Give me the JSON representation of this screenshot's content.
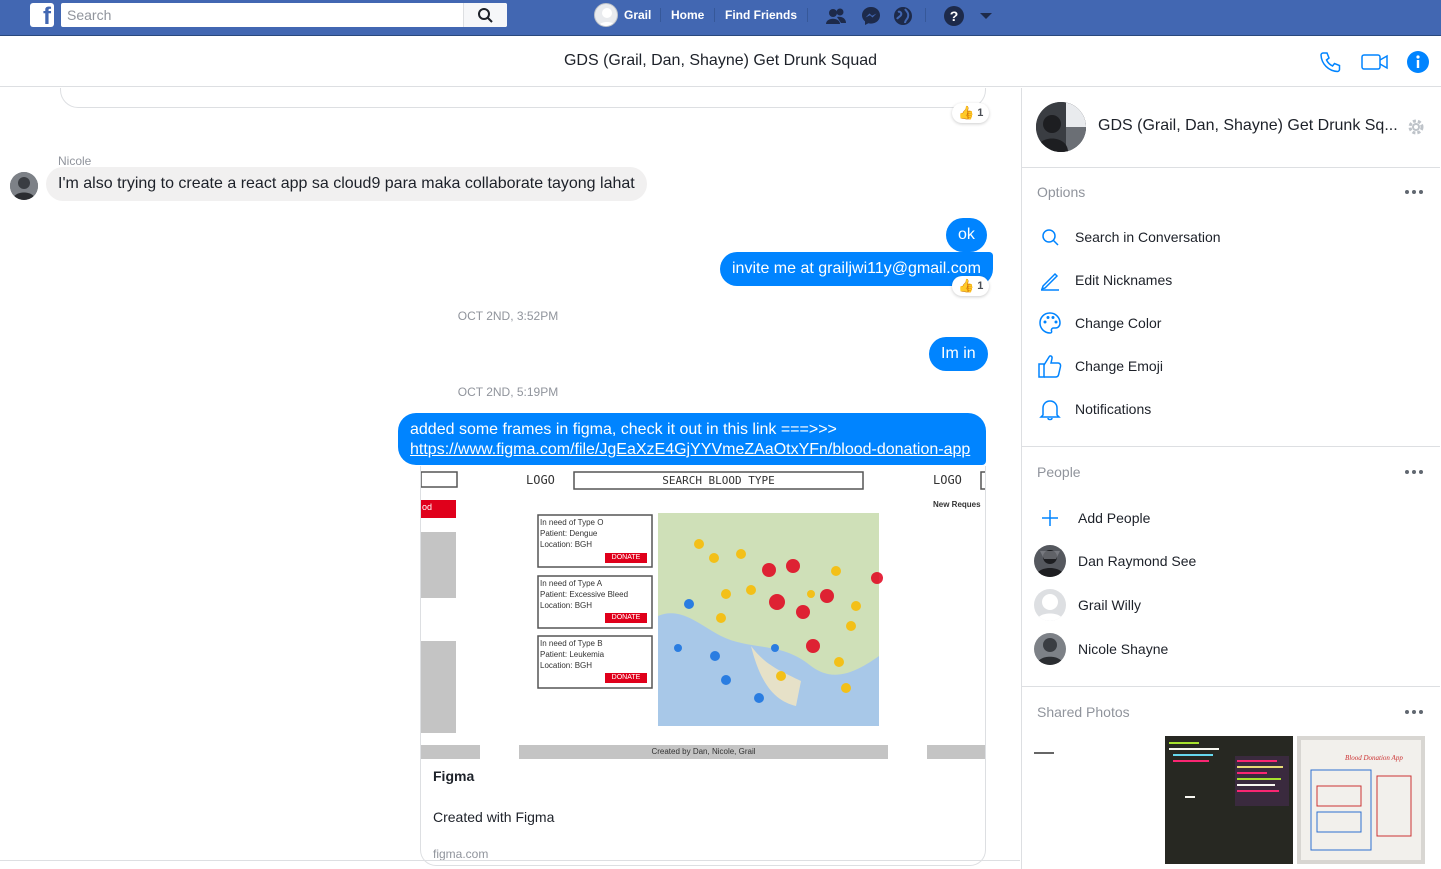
{
  "topbar": {
    "logo": "f",
    "search_placeholder": "Search",
    "user_name": "Grail",
    "home": "Home",
    "find_friends": "Find Friends",
    "icons": [
      "friend-requests-icon",
      "messenger-icon",
      "notifications-globe-icon",
      "help-icon",
      "dropdown-caret-icon"
    ]
  },
  "conversation": {
    "title": "GDS (Grail, Dan, Shayne) Get Drunk Squad",
    "header_icons": [
      "phone-icon",
      "video-icon",
      "info-icon"
    ]
  },
  "chat": {
    "top_reaction_count": "1",
    "sender_name": "Nicole",
    "incoming_message": "I'm also trying to create a react app sa cloud9 para maka collaborate tayong lahat",
    "out_ok": "ok",
    "out_invite": "invite me at grailjwi11y@gmail.com",
    "invite_reaction_count": "1",
    "timestamp_1": "OCT 2ND, 3:52PM",
    "out_im_in": "Im in",
    "timestamp_2": "OCT 2ND, 5:19PM",
    "link_message_text": "added some frames in figma, check it out in this link ===>>>",
    "link_url": "https://www.figma.com/file/JgEaXzE4GjYYVmeZAaOtxYFn/blood-donation-app",
    "preview": {
      "logo_left": "LOGO",
      "search_label": "SEARCH BLOOD TYPE",
      "logo_right": "LOGO",
      "new_request": "New Reques",
      "red_tab": "od",
      "requests": [
        {
          "line1": "In need of Type O",
          "line2": "Patient: Dengue",
          "line3": "Location: BGH",
          "button": "DONATE"
        },
        {
          "line1": "In need of Type A",
          "line2": "Patient: Excessive Bleed",
          "line3": "Location: BGH",
          "button": "DONATE"
        },
        {
          "line1": "In need of Type B",
          "line2": "Patient: Leukemia",
          "line3": "Location: BGH",
          "button": "DONATE"
        }
      ],
      "footer": "Created by Dan, Nicole, Grail"
    },
    "card_title": "Figma",
    "card_description": "Created with Figma",
    "card_domain": "figma.com"
  },
  "panel": {
    "group_name": "GDS (Grail, Dan, Shayne) Get Drunk Sq...",
    "options_title": "Options",
    "options": [
      {
        "label": "Search in Conversation",
        "icon": "search-icon"
      },
      {
        "label": "Edit Nicknames",
        "icon": "pencil-icon"
      },
      {
        "label": "Change Color",
        "icon": "palette-icon"
      },
      {
        "label": "Change Emoji",
        "icon": "thumbs-up-icon"
      },
      {
        "label": "Notifications",
        "icon": "bell-icon"
      }
    ],
    "people_title": "People",
    "add_people": "Add People",
    "people": [
      {
        "name": "Dan Raymond See"
      },
      {
        "name": "Grail Willy"
      },
      {
        "name": "Nicole Shayne"
      }
    ],
    "shared_photos_title": "Shared Photos",
    "shared_photo_text": "Blood Donation App"
  },
  "colors": {
    "brand": "#4267b2",
    "messenger_blue": "#0084ff",
    "incoming_bubble": "#f1f0f0",
    "muted_text": "#90949c",
    "donate_red": "#e0001b"
  }
}
